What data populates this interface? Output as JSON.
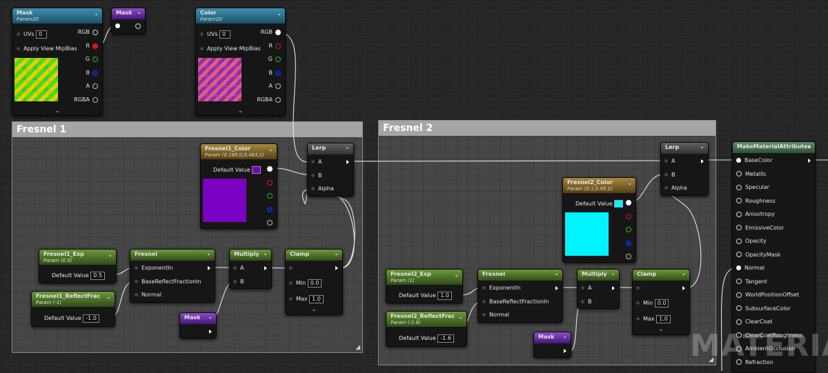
{
  "comments": [
    {
      "title": "Fresnel 1"
    },
    {
      "title": "Fresnel 2"
    }
  ],
  "nodes": {
    "mask_tex": {
      "title": "Mask",
      "subtitle": "Param2D",
      "uvs_label": "UVs",
      "uvs_value": "0",
      "mip_label": "Apply View MipBias",
      "outputs": [
        "RGB",
        "R",
        "G",
        "B",
        "A",
        "RGBA"
      ]
    },
    "mask_reroute": {
      "title": "Mask"
    },
    "color_tex": {
      "title": "Color",
      "subtitle": "Param2D",
      "uvs_label": "UVs",
      "uvs_value": "0",
      "mip_label": "Apply View MipBias",
      "outputs": [
        "RGB",
        "R",
        "G",
        "B",
        "A",
        "RGBA"
      ]
    },
    "fresnel1_color": {
      "title": "Fresnel1_Color",
      "subtitle": "Param (0.185,0,0.483,1)",
      "default_label": "Default Value",
      "swatch_color": "#7a00c2"
    },
    "lerp1": {
      "title": "Lerp",
      "inputs": [
        "A",
        "B",
        "Alpha"
      ]
    },
    "fresnel1_exp": {
      "title": "Fresnel1_Exp",
      "subtitle": "Param (0.5)",
      "default_label": "Default Value",
      "value": "0.5"
    },
    "fresnel1_reflect": {
      "title": "Fresnel1_ReflectFrac",
      "subtitle": "Param (-1)",
      "default_label": "Default Value",
      "value": "-1.0"
    },
    "fresnel1": {
      "title": "Fresnel",
      "inputs": [
        "ExponentIn",
        "BaseReflectFractionIn",
        "Normal"
      ]
    },
    "multiply1": {
      "title": "Multiply",
      "inputs": [
        "A",
        "B"
      ]
    },
    "clamp1": {
      "title": "Clamp",
      "min_label": "Min",
      "min_value": "0.0",
      "max_label": "Max",
      "max_value": "1.0"
    },
    "mask1": {
      "title": "Mask"
    },
    "fresnel2_color": {
      "title": "Fresnel2_Color",
      "subtitle": "Param (0,1,0.95,1)",
      "default_label": "Default Value",
      "swatch_color": "#00f4ff"
    },
    "lerp2": {
      "title": "Lerp",
      "inputs": [
        "A",
        "B",
        "Alpha"
      ]
    },
    "fresnel2_exp": {
      "title": "Fresnel2_Exp",
      "subtitle": "Param (1)",
      "default_label": "Default Value",
      "value": "1.0"
    },
    "fresnel2_reflect": {
      "title": "Fresnel2_ReflectFrac",
      "subtitle": "Param (-1.6)",
      "default_label": "Default Value",
      "value": "-1.6"
    },
    "fresnel2": {
      "title": "Fresnel",
      "inputs": [
        "ExponentIn",
        "BaseReflectFractionIn",
        "Normal"
      ]
    },
    "multiply2": {
      "title": "Multiply",
      "inputs": [
        "A",
        "B"
      ]
    },
    "clamp2": {
      "title": "Clamp",
      "min_label": "Min",
      "min_value": "0.0",
      "max_label": "Max",
      "max_value": "1.0"
    },
    "mask2": {
      "title": "Mask"
    },
    "make_attrs": {
      "title": "MakeMaterialAttributes",
      "inputs": [
        "BaseColor",
        "Metallic",
        "Specular",
        "Roughness",
        "Anisotropy",
        "EmissiveColor",
        "Opacity",
        "OpacityMask",
        "Normal",
        "Tangent",
        "WorldPositionOffset",
        "SubsurfaceColor",
        "ClearCoat",
        "ClearCoatRoughness",
        "AmbientOcclusion",
        "Refraction"
      ]
    }
  },
  "watermark": "MATERIAL",
  "colors": {
    "red_pin": "#e01818",
    "green_pin": "#22c022",
    "blue_pin": "#1030e0",
    "header_blue": "#2f7794",
    "header_green": "#55792b",
    "header_gold": "#8a6c2b",
    "header_purple": "#6a2ea8"
  },
  "icons": [
    "chevron-down-icon",
    "pin-icon",
    "resize-grip-icon"
  ]
}
